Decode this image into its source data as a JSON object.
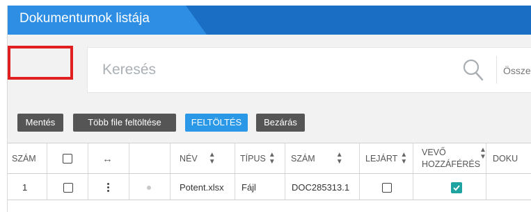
{
  "window": {
    "title": "Dokumentumok listája"
  },
  "search": {
    "placeholder": "Keresés",
    "next_label": "Össze"
  },
  "toolbar": {
    "save_label": "Mentés",
    "multi_upload_label": "Több file feltöltése",
    "upload_label": "FELTÖLTÉS",
    "close_label": "Bezárás"
  },
  "table": {
    "headers": {
      "szam": "SZÁM",
      "nev": "NÉV",
      "tipus": "TÍPUS",
      "szam2": "SZÁM",
      "lejart": "LEJÁRT",
      "vevo_line1": "VEVŐ",
      "vevo_line2": "HOZZÁFÉRÉS",
      "doku": "DOKU"
    },
    "rows": [
      {
        "num": "1",
        "name": "Potent.xlsx",
        "type": "Fájl",
        "doc_number": "DOC285313.1",
        "expired": false,
        "customer_access": true
      }
    ]
  },
  "colors": {
    "title_bar": "#1a6fc4",
    "title_tab": "#2e8ee3",
    "upload_button": "#2a98e6",
    "checked": "#1fa3a0",
    "highlight": "#e02020"
  }
}
